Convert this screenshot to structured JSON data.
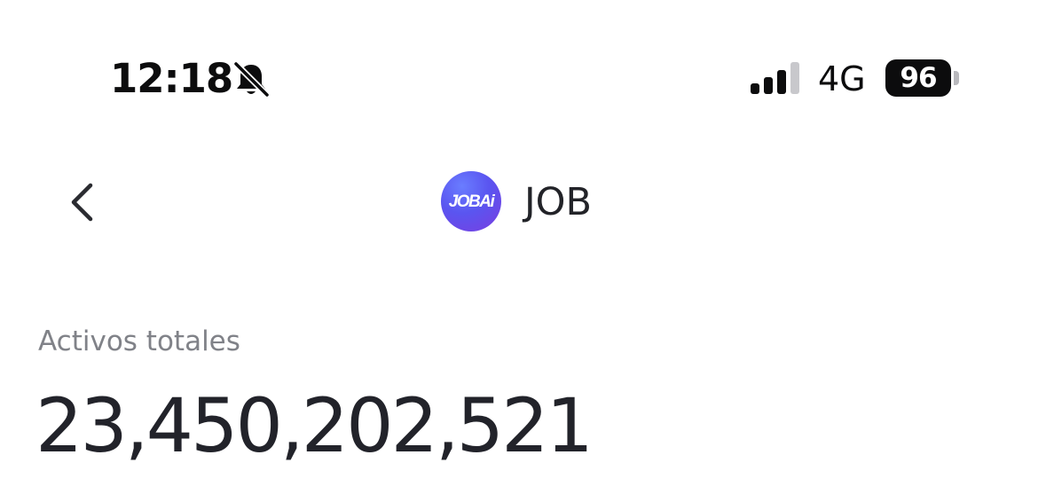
{
  "status_bar": {
    "time": "12:18",
    "silent_icon": "bell-slash-icon",
    "signal_icon": "cellular-signal-icon",
    "signal_bars_active": 3,
    "signal_bars_total": 4,
    "network": "4G",
    "battery_level": "96",
    "battery_icon": "battery-icon"
  },
  "header": {
    "back_icon": "chevron-left-icon",
    "token_logo_text": "JOBAi",
    "token_name": "JOB",
    "token_logo_color": "#5b50ee"
  },
  "balance": {
    "label": "Activos totales",
    "value": "23,450,202,521"
  }
}
